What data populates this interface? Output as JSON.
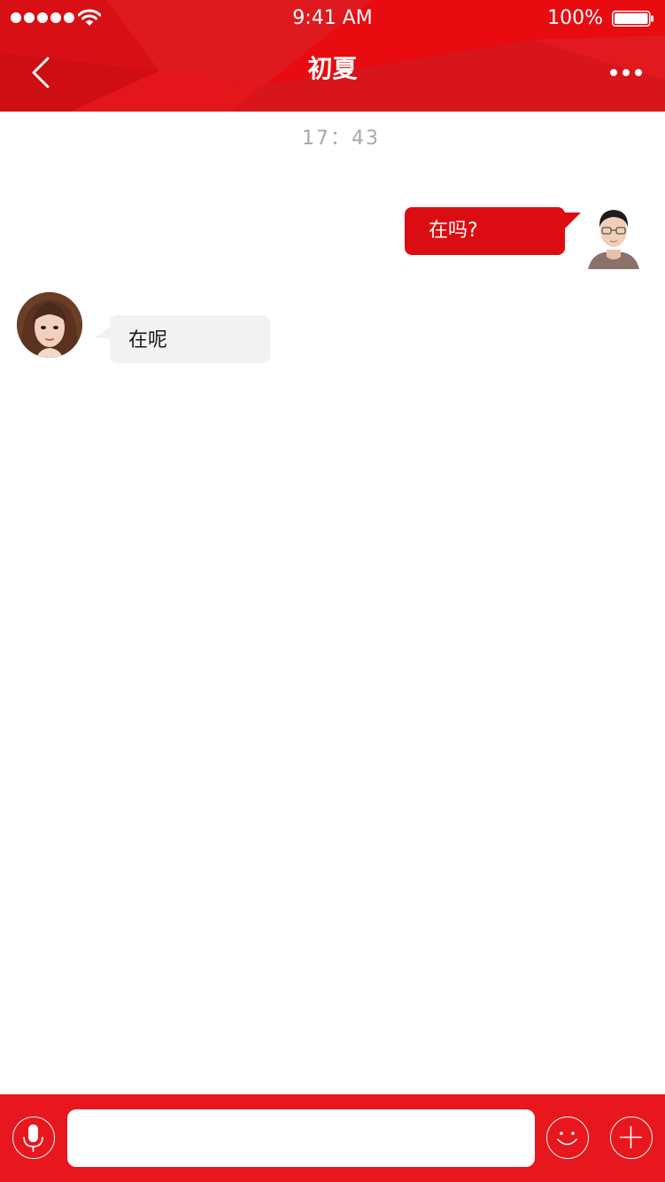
{
  "status_bar": {
    "time": "9:41 AM",
    "battery_percent": "100%",
    "battery_level": 1.0,
    "signal_bars": 5
  },
  "nav": {
    "title": "初夏"
  },
  "conversation": {
    "timestamp": "17：43",
    "messages": [
      {
        "direction": "outgoing",
        "text": "在吗?"
      },
      {
        "direction": "incoming",
        "text": "在呢"
      }
    ]
  },
  "input_bar": {
    "value": "",
    "placeholder": ""
  },
  "colors": {
    "brand_red": "#e30e14",
    "outgoing_bubble": "#dc0d12",
    "incoming_bubble": "#f2f2f2",
    "timestamp_gray": "#a8a8a8"
  },
  "icons": {
    "back": "chevron-left-icon",
    "more": "more-dots-icon",
    "voice": "microphone-icon",
    "emoji": "smiley-icon",
    "plus": "plus-icon"
  }
}
